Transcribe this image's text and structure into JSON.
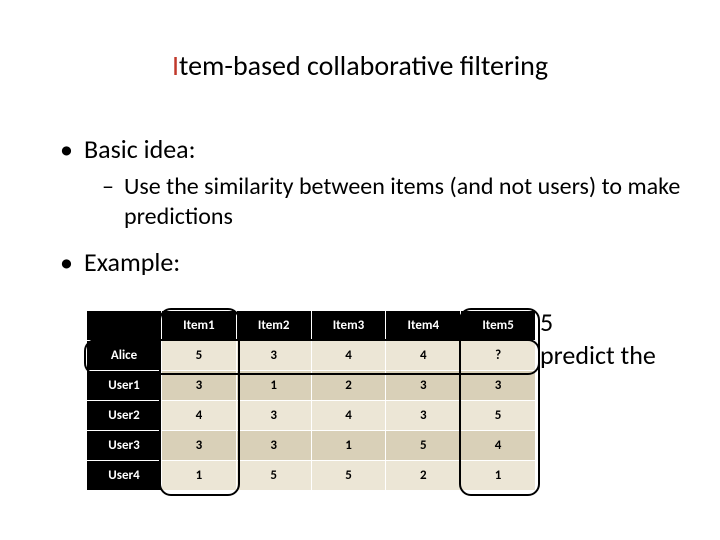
{
  "title": {
    "accent": "I",
    "rest": "tem-based collaborative filtering"
  },
  "bullets": {
    "b1": "Basic idea:",
    "s1": "Use the similarity between items (and not users) to make predictions",
    "b2": "Example:"
  },
  "side": {
    "line1": "5",
    "line2": "predict the"
  },
  "chart_data": {
    "type": "table",
    "columns": [
      "Item1",
      "Item2",
      "Item3",
      "Item4",
      "Item5"
    ],
    "rows": [
      {
        "name": "Alice",
        "values": [
          "5",
          "3",
          "4",
          "4",
          "?"
        ]
      },
      {
        "name": "User1",
        "values": [
          "3",
          "1",
          "2",
          "3",
          "3"
        ]
      },
      {
        "name": "User2",
        "values": [
          "4",
          "3",
          "4",
          "3",
          "5"
        ]
      },
      {
        "name": "User3",
        "values": [
          "3",
          "3",
          "1",
          "5",
          "4"
        ]
      },
      {
        "name": "User4",
        "values": [
          "1",
          "5",
          "5",
          "2",
          "1"
        ]
      }
    ],
    "highlights": {
      "row_index": 0,
      "col_indices": [
        0,
        4
      ]
    }
  }
}
